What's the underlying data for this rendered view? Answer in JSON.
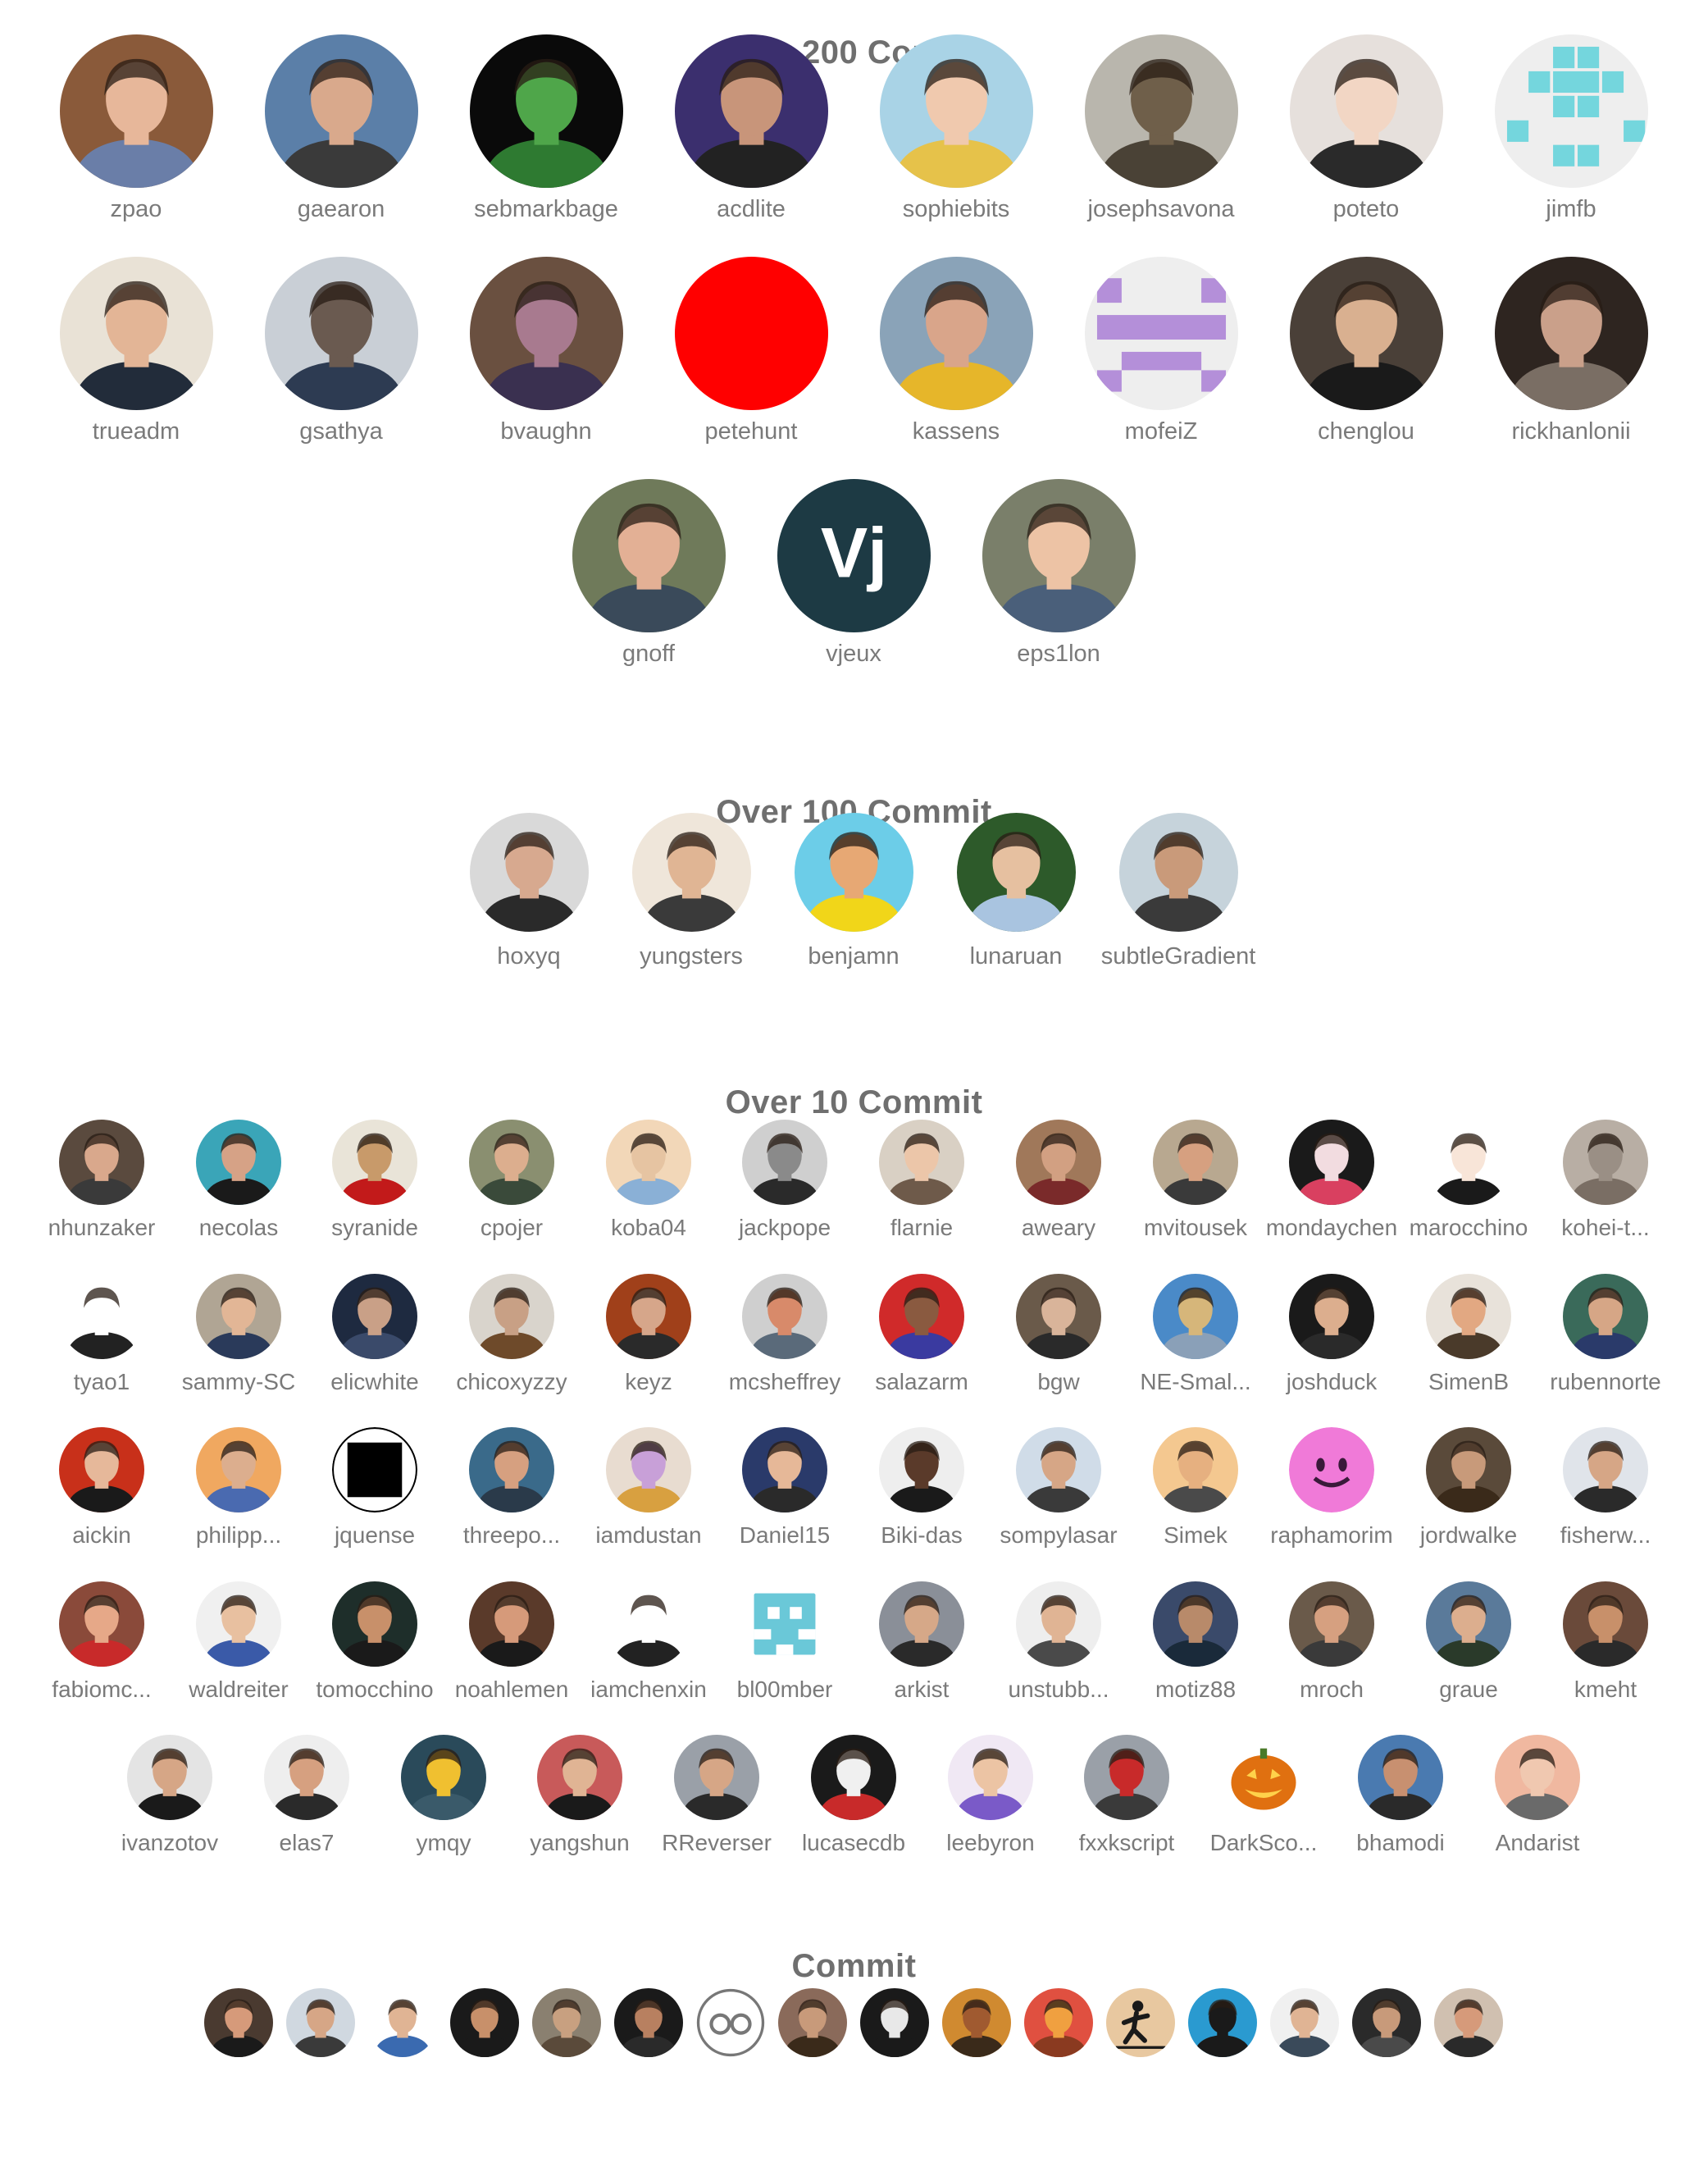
{
  "sections": [
    {
      "title": "Over 200 Commit",
      "contributors": [
        {
          "name": "zpao",
          "avatar": {
            "bg": "#8a5a3a",
            "face": "#e7b79a",
            "shirt": "#6a7ea8"
          }
        },
        {
          "name": "gaearon",
          "avatar": {
            "bg": "#5b7fa8",
            "face": "#d9a98c",
            "shirt": "#3a3a3a"
          }
        },
        {
          "name": "sebmarkbage",
          "avatar": {
            "bg": "#0a0a0a",
            "face": "#4fa64a",
            "shirt": "#2e7a31"
          }
        },
        {
          "name": "acdlite",
          "avatar": {
            "bg": "#3b2f6e",
            "face": "#c8957a",
            "shirt": "#222222"
          }
        },
        {
          "name": "sophiebits",
          "avatar": {
            "bg": "#a9d3e6",
            "face": "#f0c9ae",
            "shirt": "#e6c24a"
          }
        },
        {
          "name": "josephsavona",
          "avatar": {
            "bg": "#b9b6ad",
            "face": "#6f5f4a",
            "shirt": "#4a4236"
          }
        },
        {
          "name": "poteto",
          "avatar": {
            "bg": "#e6e0dc",
            "face": "#f2d6c4",
            "shirt": "#2a2a2a"
          }
        },
        {
          "name": "jimfb",
          "avatar": {
            "bg": "#eeeeee",
            "pattern": "identicon",
            "color": "#74d6dd"
          }
        },
        {
          "name": "trueadm",
          "avatar": {
            "bg": "#e9e2d6",
            "face": "#e3b596",
            "shirt": "#222c3a"
          }
        },
        {
          "name": "gsathya",
          "avatar": {
            "bg": "#c9cfd6",
            "face": "#6a5a50",
            "shirt": "#2d3b52"
          }
        },
        {
          "name": "bvaughn",
          "avatar": {
            "bg": "#6a5040",
            "face": "#a87a8f",
            "shirt": "#3a3050"
          }
        },
        {
          "name": "petehunt",
          "avatar": {
            "bg": "#ff0000",
            "solid": true
          }
        },
        {
          "name": "kassens",
          "avatar": {
            "bg": "#8aa3b8",
            "face": "#d9a58a",
            "shirt": "#e6b62a"
          }
        },
        {
          "name": "mofeiZ",
          "avatar": {
            "bg": "#eeeeee",
            "pattern": "identicon2",
            "color": "#b48fd9"
          }
        },
        {
          "name": "chenglou",
          "avatar": {
            "bg": "#4a4038",
            "face": "#d9b090",
            "shirt": "#1a1a1a"
          }
        },
        {
          "name": "rickhanlonii",
          "avatar": {
            "bg": "#2e2520",
            "face": "#caa08a",
            "shirt": "#7a6e64"
          }
        },
        {
          "name": "gnoff",
          "avatar": {
            "bg": "#6f7a5a",
            "face": "#e3b095",
            "shirt": "#3a4a5a"
          }
        },
        {
          "name": "vjeux",
          "avatar": {
            "bg": "#1d3a44",
            "monogram": "Vj"
          }
        },
        {
          "name": "eps1lon",
          "avatar": {
            "bg": "#7a7f6a",
            "face": "#edc3a5",
            "shirt": "#4a5f7a"
          }
        }
      ]
    },
    {
      "title": "Over 100 Commit",
      "contributors": [
        {
          "name": "hoxyq",
          "avatar": {
            "bg": "#d9d9d9",
            "face": "#d7a98f",
            "shirt": "#2a2a2a"
          }
        },
        {
          "name": "yungsters",
          "avatar": {
            "bg": "#efe6da",
            "face": "#e0b594",
            "shirt": "#3a3a3a"
          }
        },
        {
          "name": "benjamn",
          "avatar": {
            "bg": "#6ccde8",
            "face": "#e7a874",
            "shirt": "#f1d619"
          }
        },
        {
          "name": "lunaruan",
          "avatar": {
            "bg": "#2d5a2a",
            "face": "#e6c0a0",
            "shirt": "#a9c4e0"
          }
        },
        {
          "name": "subtleGradient",
          "avatar": {
            "bg": "#c6d3db",
            "face": "#c99a7a",
            "shirt": "#3a3a3a"
          }
        }
      ]
    },
    {
      "title": "Over 10 Commit",
      "contributors": [
        {
          "name": "nhunzaker",
          "avatar": {
            "bg": "#5a4a3e",
            "face": "#d9a88c",
            "shirt": "#3a3a3a"
          }
        },
        {
          "name": "necolas",
          "avatar": {
            "bg": "#3aa5b8",
            "face": "#d6a286",
            "shirt": "#1a1a1a"
          }
        },
        {
          "name": "syranide",
          "avatar": {
            "bg": "#e9e4d8",
            "face": "#c89a6a",
            "shirt": "#c21a1a"
          }
        },
        {
          "name": "cpojer",
          "avatar": {
            "bg": "#8a8f70",
            "face": "#dcae8e",
            "shirt": "#3a4a3a"
          }
        },
        {
          "name": "koba04",
          "avatar": {
            "bg": "#f2d7b8",
            "face": "#e6c4a2",
            "shirt": "#8ab0d6"
          }
        },
        {
          "name": "jackpope",
          "avatar": {
            "bg": "#cfcfcf",
            "face": "#8a8a8a",
            "shirt": "#2a2a2a"
          }
        },
        {
          "name": "flarnie",
          "avatar": {
            "bg": "#d9d0c4",
            "face": "#ecc6a9",
            "shirt": "#6e5a4a"
          }
        },
        {
          "name": "aweary",
          "avatar": {
            "bg": "#a0785a",
            "face": "#d2a082",
            "shirt": "#7a2a2a"
          }
        },
        {
          "name": "mvitousek",
          "avatar": {
            "bg": "#b8a890",
            "face": "#d6a080",
            "shirt": "#3a3a3a"
          }
        },
        {
          "name": "mondaychen",
          "avatar": {
            "bg": "#1a1a1a",
            "face": "#f2dce0",
            "shirt": "#d94060"
          }
        },
        {
          "name": "marocchino",
          "avatar": {
            "bg": "#ffffff",
            "face": "#f8e5d8",
            "shirt": "#1a1a1a"
          }
        },
        {
          "name": "kohei-t...",
          "avatar": {
            "bg": "#b8aea4",
            "face": "#9a8f85",
            "shirt": "#7a6e64"
          }
        },
        {
          "name": "tyao1",
          "avatar": {
            "bg": "#ffffff",
            "face": "#ffffff",
            "shirt": "#222222"
          }
        },
        {
          "name": "sammy-SC",
          "avatar": {
            "bg": "#b0a594",
            "face": "#e2b696",
            "shirt": "#2a3a5a"
          }
        },
        {
          "name": "elicwhite",
          "avatar": {
            "bg": "#1e2a40",
            "face": "#c9a087",
            "shirt": "#3a4a6a"
          }
        },
        {
          "name": "chicoxyzzy",
          "avatar": {
            "bg": "#d9d4cc",
            "face": "#c8a085",
            "shirt": "#6e4a2a"
          }
        },
        {
          "name": "keyz",
          "avatar": {
            "bg": "#a0401a",
            "face": "#d6a68a",
            "shirt": "#2a2a2a"
          }
        },
        {
          "name": "mcsheffrey",
          "avatar": {
            "bg": "#cfcfcf",
            "face": "#d88a6a",
            "shirt": "#5a6a7a"
          }
        },
        {
          "name": "salazarm",
          "avatar": {
            "bg": "#d02a2a",
            "face": "#8a5a40",
            "shirt": "#3a3aa0"
          }
        },
        {
          "name": "bgw",
          "avatar": {
            "bg": "#6a5a4a",
            "face": "#d9b49a",
            "shirt": "#2a2a2a"
          }
        },
        {
          "name": "NE-Smal...",
          "avatar": {
            "bg": "#4a8ac8",
            "face": "#d6b67a",
            "shirt": "#8aa0b8"
          }
        },
        {
          "name": "joshduck",
          "avatar": {
            "bg": "#1a1a1a",
            "face": "#dcae8e",
            "shirt": "#2a2a2a"
          }
        },
        {
          "name": "SimenB",
          "avatar": {
            "bg": "#e8e2da",
            "face": "#e2a882",
            "shirt": "#4a3a2a"
          }
        },
        {
          "name": "rubennorte",
          "avatar": {
            "bg": "#3a6a5a",
            "face": "#d6a686",
            "shirt": "#2a3a6a"
          }
        },
        {
          "name": "aickin",
          "avatar": {
            "bg": "#c8301a",
            "face": "#e6b89a",
            "shirt": "#1a1a1a"
          }
        },
        {
          "name": "philipp...",
          "avatar": {
            "bg": "#f0a860",
            "face": "#dcae8e",
            "shirt": "#4a6ab0"
          }
        },
        {
          "name": "jquense",
          "avatar": {
            "bg": "#ffffff",
            "pattern": "square",
            "color": "#000000"
          }
        },
        {
          "name": "threepo...",
          "avatar": {
            "bg": "#3a6a8a",
            "face": "#d6a080",
            "shirt": "#2a3a4a"
          }
        },
        {
          "name": "iamdustan",
          "avatar": {
            "bg": "#e8dcd0",
            "face": "#c8a0d8",
            "shirt": "#d8a040"
          }
        },
        {
          "name": "Daniel15",
          "avatar": {
            "bg": "#2a3a6a",
            "face": "#e6b898",
            "shirt": "#2a2a2a"
          }
        },
        {
          "name": "Biki-das",
          "avatar": {
            "bg": "#eeeeee",
            "face": "#5a3a2a",
            "shirt": "#1a1a1a"
          }
        },
        {
          "name": "sompylasar",
          "avatar": {
            "bg": "#d0dce8",
            "face": "#d6a686",
            "shirt": "#3a3a3a"
          }
        },
        {
          "name": "Simek",
          "avatar": {
            "bg": "#f4c890",
            "face": "#e6b080",
            "shirt": "#4a4a4a"
          }
        },
        {
          "name": "raphamorim",
          "avatar": {
            "bg": "#ffffff",
            "pattern": "smiley",
            "color": "#f07ad8"
          }
        },
        {
          "name": "jordwalke",
          "avatar": {
            "bg": "#5a4a3a",
            "face": "#c89a7a",
            "shirt": "#3a2a1a"
          }
        },
        {
          "name": "fisherw...",
          "avatar": {
            "bg": "#e0e4ea",
            "face": "#d6a686",
            "shirt": "#2a2a2a"
          }
        },
        {
          "name": "fabiomc...",
          "avatar": {
            "bg": "#8a4a3a",
            "face": "#e6a888",
            "shirt": "#c82a2a"
          }
        },
        {
          "name": "waldreiter",
          "avatar": {
            "bg": "#f0f0f0",
            "face": "#e8c0a0",
            "shirt": "#3a5aa8"
          }
        },
        {
          "name": "tomocchino",
          "avatar": {
            "bg": "#1e2e2a",
            "face": "#c8906a",
            "shirt": "#1a1a1a"
          }
        },
        {
          "name": "noahlemen",
          "avatar": {
            "bg": "#5a3a2a",
            "face": "#d69a7a",
            "shirt": "#1a1a1a"
          }
        },
        {
          "name": "iamchenxin",
          "avatar": {
            "bg": "#ffffff",
            "face": "#ffffff",
            "shirt": "#222222"
          }
        },
        {
          "name": "bl00mber",
          "avatar": {
            "bg": "#ffffff",
            "pattern": "invader",
            "color": "#6ac8d8"
          }
        },
        {
          "name": "arkist",
          "avatar": {
            "bg": "#8a8f98",
            "face": "#d6a888",
            "shirt": "#2a2a2a"
          }
        },
        {
          "name": "unstubb...",
          "avatar": {
            "bg": "#eeeeee",
            "face": "#e0b494",
            "shirt": "#4a4a4a"
          }
        },
        {
          "name": "motiz88",
          "avatar": {
            "bg": "#3a4a6a",
            "face": "#b88a6a",
            "shirt": "#1a2a3a"
          }
        },
        {
          "name": "mroch",
          "avatar": {
            "bg": "#6a5a4a",
            "face": "#d6a080",
            "shirt": "#3a3a3a"
          }
        },
        {
          "name": "graue",
          "avatar": {
            "bg": "#5a7a9a",
            "face": "#dcae8e",
            "shirt": "#2a3a2a"
          }
        },
        {
          "name": "kmeht",
          "avatar": {
            "bg": "#6a4a3a",
            "face": "#c8906a",
            "shirt": "#2a2a2a"
          }
        },
        {
          "name": "ivanzotov",
          "avatar": {
            "bg": "#e4e4e4",
            "face": "#d6a686",
            "shirt": "#1a1a1a"
          }
        },
        {
          "name": "elas7",
          "avatar": {
            "bg": "#eeeeee",
            "face": "#d6a080",
            "shirt": "#2a2a2a"
          }
        },
        {
          "name": "ymqy",
          "avatar": {
            "bg": "#2a4a5a",
            "face": "#f0c030",
            "shirt": "#3a5a6a"
          }
        },
        {
          "name": "yangshun",
          "avatar": {
            "bg": "#c85a5a",
            "face": "#e0b494",
            "shirt": "#1a1a1a"
          }
        },
        {
          "name": "RReverser",
          "avatar": {
            "bg": "#9aa0a8",
            "face": "#d6a686",
            "shirt": "#2a2a2a"
          }
        },
        {
          "name": "lucasecdb",
          "avatar": {
            "bg": "#1a1a1a",
            "face": "#f0f0f0",
            "shirt": "#c82a2a"
          }
        },
        {
          "name": "leebyron",
          "avatar": {
            "bg": "#f0e8f4",
            "face": "#ecc4a4",
            "shirt": "#7a5ac8"
          }
        },
        {
          "name": "fxxkscript",
          "avatar": {
            "bg": "#9aa0a8",
            "face": "#c82a2a",
            "shirt": "#3a3a3a"
          }
        },
        {
          "name": "DarkSco...",
          "avatar": {
            "bg": "#ffffff",
            "pattern": "pumpkin",
            "color": "#e07010"
          }
        },
        {
          "name": "bhamodi",
          "avatar": {
            "bg": "#4a7ab0",
            "face": "#c89070",
            "shirt": "#2a2a2a"
          }
        },
        {
          "name": "Andarist",
          "avatar": {
            "bg": "#f0b8a0",
            "face": "#f0c8b0",
            "shirt": "#6a6a6a"
          }
        }
      ]
    },
    {
      "title": "Commit",
      "contributors": [
        {
          "avatar": {
            "bg": "#4a3a30",
            "face": "#d69a7a",
            "shirt": "#1a1a1a"
          }
        },
        {
          "avatar": {
            "bg": "#d0d8e0",
            "face": "#d6a686",
            "shirt": "#3a3a3a"
          }
        },
        {
          "avatar": {
            "bg": "#ffffff",
            "face": "#e0b494",
            "shirt": "#3a6ab0"
          }
        },
        {
          "avatar": {
            "bg": "#1a1a1a",
            "face": "#c8906a",
            "shirt": "#1a1a1a"
          }
        },
        {
          "avatar": {
            "bg": "#8a8070",
            "face": "#c8a080",
            "shirt": "#5a4a3a"
          }
        },
        {
          "avatar": {
            "bg": "#1a1a1a",
            "face": "#b88060",
            "shirt": "#2a2a2a"
          }
        },
        {
          "avatar": {
            "bg": "#ffffff",
            "pattern": "eyes",
            "color": "#777777"
          }
        },
        {
          "avatar": {
            "bg": "#8a6a5a",
            "face": "#c89a7a",
            "shirt": "#3a2a1a"
          }
        },
        {
          "avatar": {
            "bg": "#1a1a1a",
            "face": "#e8e8e8",
            "shirt": "#1a1a1a"
          }
        },
        {
          "avatar": {
            "bg": "#d08a30",
            "face": "#a05a30",
            "shirt": "#3a2a1a"
          }
        },
        {
          "avatar": {
            "bg": "#e05040",
            "face": "#f0a040",
            "shirt": "#8a3a20"
          }
        },
        {
          "avatar": {
            "bg": "#e8c8a0",
            "pattern": "runner",
            "color": "#1a1a1a"
          }
        },
        {
          "avatar": {
            "bg": "#2a9ad0",
            "face": "#1a1a1a",
            "shirt": "#1a1a1a"
          }
        },
        {
          "avatar": {
            "bg": "#f0f0f0",
            "face": "#e0b494",
            "shirt": "#3a4a5a"
          }
        },
        {
          "avatar": {
            "bg": "#2a2a2a",
            "face": "#c89a7a",
            "shirt": "#4a4a4a"
          }
        },
        {
          "avatar": {
            "bg": "#d0c0b0",
            "face": "#d69a7a",
            "shirt": "#2a2a2a"
          }
        }
      ]
    }
  ]
}
